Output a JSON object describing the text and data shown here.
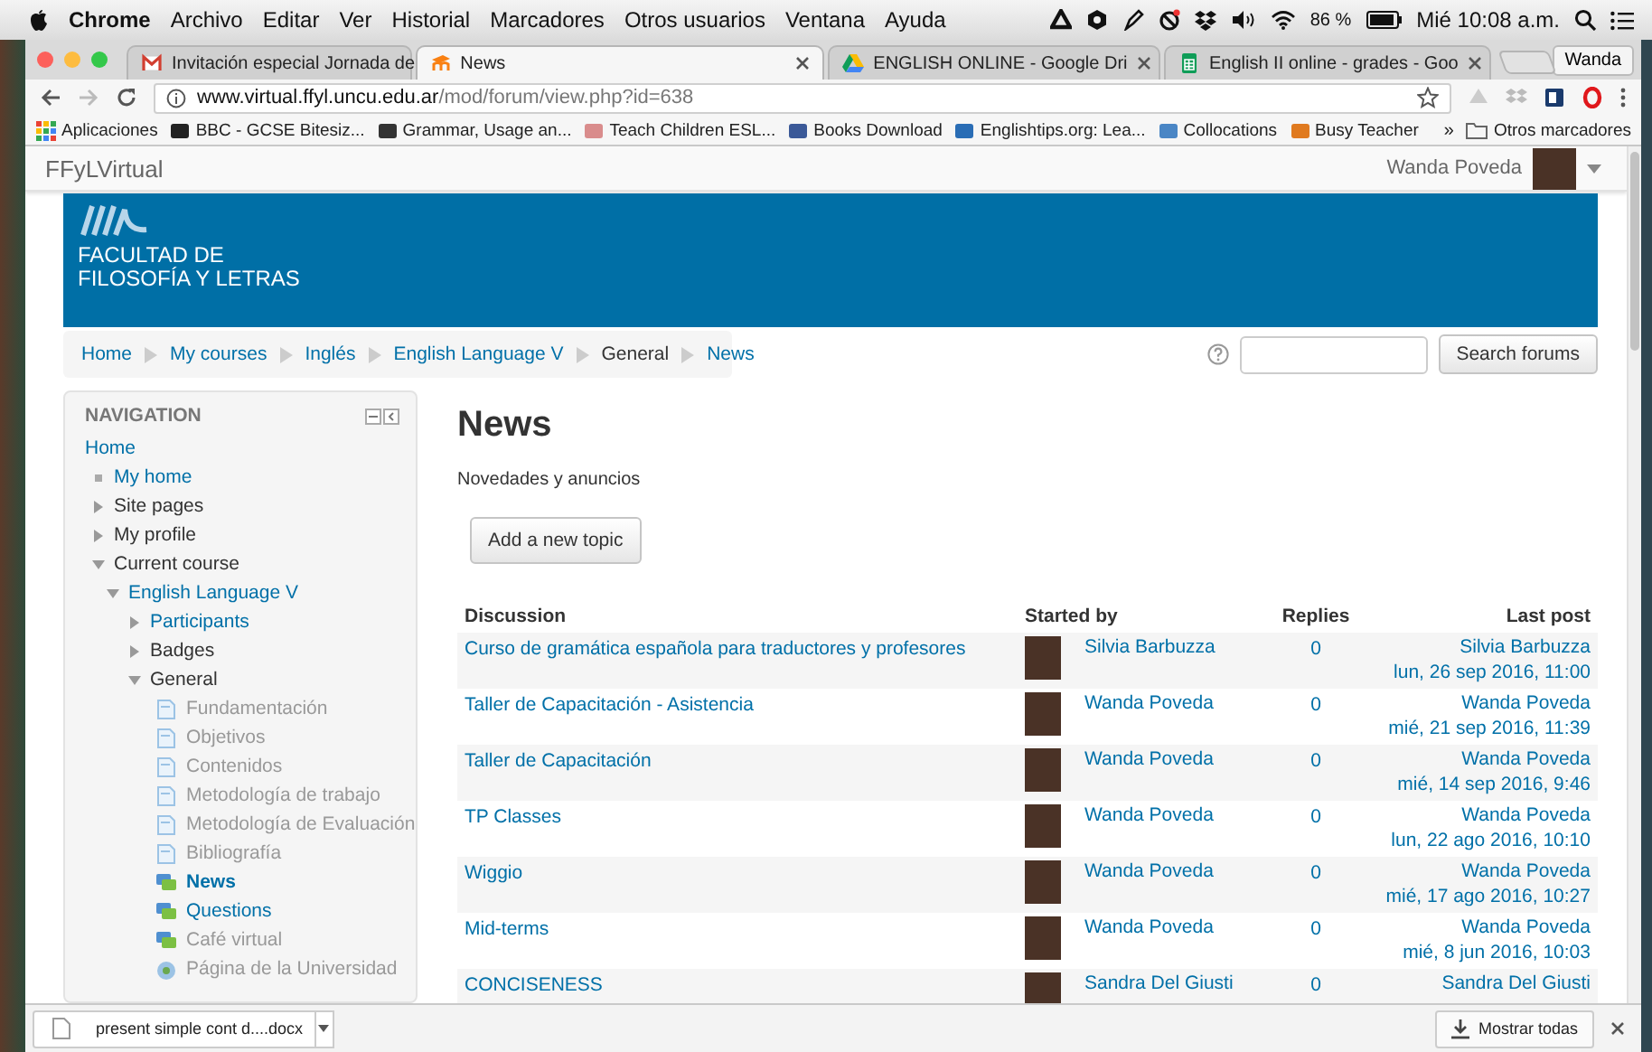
{
  "menu_bar": {
    "app": "Chrome",
    "menus": [
      "Archivo",
      "Editar",
      "Ver",
      "Historial",
      "Marcadores",
      "Otros usuarios",
      "Ventana",
      "Ayuda"
    ],
    "battery": "86 %",
    "clock": "Mié 10:08 a.m."
  },
  "browser": {
    "tabs": [
      {
        "title": "Invitación especial Jornada de",
        "selected": false
      },
      {
        "title": "News",
        "selected": true
      },
      {
        "title": "ENGLISH ONLINE - Google Dri",
        "selected": false
      },
      {
        "title": "English II online - grades - Goo",
        "selected": false
      }
    ],
    "profile": "Wanda",
    "url": {
      "host": "www.virtual.ffyl.uncu.edu.ar",
      "path": "/mod/forum/view.php?id=638"
    },
    "bookmarks": [
      {
        "label": "Aplicaciones"
      },
      {
        "label": "BBC - GCSE Bitesiz..."
      },
      {
        "label": "Grammar, Usage an..."
      },
      {
        "label": "Teach Children ESL..."
      },
      {
        "label": "Books Download"
      },
      {
        "label": "Englishtips.org: Lea..."
      },
      {
        "label": "Collocations"
      },
      {
        "label": "Busy Teacher"
      }
    ],
    "bookmarks_more": "»",
    "other_bookmarks": "Otros marcadores"
  },
  "page": {
    "site_name": "FFyLVirtual",
    "user": "Wanda Poveda",
    "banner": [
      "FACULTAD DE",
      "FILOSOFÍA Y LETRAS"
    ],
    "breadcrumbs": [
      {
        "label": "Home",
        "link": true
      },
      {
        "label": "My courses",
        "link": true
      },
      {
        "label": "Inglés",
        "link": true
      },
      {
        "label": "English Language V",
        "link": true
      },
      {
        "label": "General",
        "link": false
      },
      {
        "label": "News",
        "link": true
      }
    ],
    "search_button": "Search forums",
    "navigation": {
      "title": "NAVIGATION",
      "items": [
        {
          "label": "Home",
          "kind": "heading"
        },
        {
          "label": "My home",
          "kind": "item",
          "link": true
        },
        {
          "label": "Site pages",
          "kind": "item",
          "link": false,
          "expanded": false
        },
        {
          "label": "My profile",
          "kind": "item",
          "link": false,
          "expanded": false
        },
        {
          "label": "Current course",
          "kind": "item",
          "link": false,
          "expanded": true,
          "children": [
            {
              "label": "English Language V",
              "kind": "item",
              "link": true,
              "expanded": true,
              "children": [
                {
                  "label": "Participants",
                  "kind": "item",
                  "link": true,
                  "expanded": false
                },
                {
                  "label": "Badges",
                  "kind": "item",
                  "link": false,
                  "expanded": false
                },
                {
                  "label": "General",
                  "kind": "item",
                  "link": false,
                  "expanded": true,
                  "children": [
                    {
                      "label": "Fundamentación",
                      "kind": "page",
                      "dimmed": true,
                      "selected": false
                    },
                    {
                      "label": "Objetivos",
                      "kind": "page",
                      "dimmed": true,
                      "selected": false
                    },
                    {
                      "label": "Contenidos",
                      "kind": "page",
                      "dimmed": true,
                      "selected": false
                    },
                    {
                      "label": "Metodología de trabajo",
                      "kind": "page",
                      "dimmed": true,
                      "selected": false
                    },
                    {
                      "label": "Metodología de Evaluación",
                      "kind": "page",
                      "dimmed": true,
                      "selected": false
                    },
                    {
                      "label": "Bibliografía",
                      "kind": "page",
                      "dimmed": true,
                      "selected": false
                    },
                    {
                      "label": "News",
                      "kind": "forum",
                      "dimmed": false,
                      "selected": true
                    },
                    {
                      "label": "Questions",
                      "kind": "forum",
                      "dimmed": false,
                      "selected": false
                    },
                    {
                      "label": "Café virtual",
                      "kind": "forum",
                      "dimmed": true,
                      "selected": false
                    },
                    {
                      "label": "Página de la Universidad",
                      "kind": "url",
                      "dimmed": true,
                      "selected": false
                    }
                  ]
                }
              ]
            }
          ]
        }
      ]
    },
    "heading": "News",
    "intro": "Novedades y anuncios",
    "add_button": "Add a new topic",
    "table": {
      "columns": [
        "Discussion",
        "Started by",
        "Replies",
        "Last post"
      ],
      "rows": [
        {
          "topic": "Curso de gramática española para traductores y profesores",
          "author": "Silvia Barbuzza",
          "replies": "0",
          "last_author": "Silvia Barbuzza",
          "last_date": "lun, 26 sep 2016, 11:00"
        },
        {
          "topic": "Taller de Capacitación - Asistencia",
          "author": "Wanda Poveda",
          "replies": "0",
          "last_author": "Wanda Poveda",
          "last_date": "mié, 21 sep 2016, 11:39"
        },
        {
          "topic": "Taller de Capacitación",
          "author": "Wanda Poveda",
          "replies": "0",
          "last_author": "Wanda Poveda",
          "last_date": "mié, 14 sep 2016, 9:46"
        },
        {
          "topic": "TP Classes",
          "author": "Wanda Poveda",
          "replies": "0",
          "last_author": "Wanda Poveda",
          "last_date": "lun, 22 ago 2016, 10:10"
        },
        {
          "topic": "Wiggio",
          "author": "Wanda Poveda",
          "replies": "0",
          "last_author": "Wanda Poveda",
          "last_date": "mié, 17 ago 2016, 10:27"
        },
        {
          "topic": "Mid-terms",
          "author": "Wanda Poveda",
          "replies": "0",
          "last_author": "Wanda Poveda",
          "last_date": "mié, 8 jun 2016, 10:03"
        },
        {
          "topic": "CONCISENESS",
          "author": "Sandra Del Giusti",
          "replies": "0",
          "last_author": "Sandra Del Giusti"
        }
      ]
    }
  },
  "downloads": {
    "file": "present simple cont d....docx",
    "show_all": "Mostrar todas"
  }
}
